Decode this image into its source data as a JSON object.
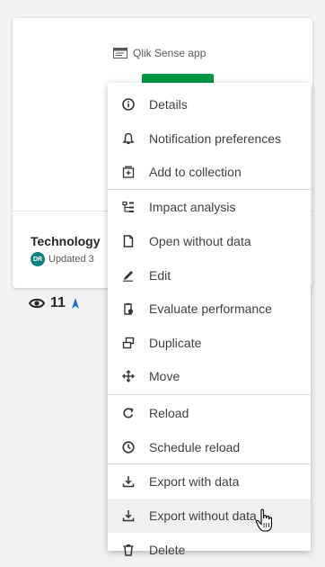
{
  "card": {
    "app_type_label": "Qlik Sense app",
    "title": "Technology",
    "owner_initials": "DR",
    "updated_text": "Updated 3",
    "views_count": "11"
  },
  "menu": {
    "items": [
      {
        "label": "Details",
        "icon": "info-icon"
      },
      {
        "label": "Notification preferences",
        "icon": "bell-icon"
      },
      {
        "label": "Add to collection",
        "icon": "add-collection-icon"
      },
      {
        "label": "Impact analysis",
        "icon": "impact-analysis-icon"
      },
      {
        "label": "Open without data",
        "icon": "document-icon"
      },
      {
        "label": "Edit",
        "icon": "pencil-icon"
      },
      {
        "label": "Evaluate performance",
        "icon": "evaluate-icon"
      },
      {
        "label": "Duplicate",
        "icon": "duplicate-icon"
      },
      {
        "label": "Move",
        "icon": "move-icon"
      },
      {
        "label": "Reload",
        "icon": "reload-icon"
      },
      {
        "label": "Schedule reload",
        "icon": "clock-icon"
      },
      {
        "label": "Export with data",
        "icon": "download-icon"
      },
      {
        "label": "Export without data",
        "icon": "download-icon"
      },
      {
        "label": "Delete",
        "icon": "trash-icon"
      }
    ]
  }
}
